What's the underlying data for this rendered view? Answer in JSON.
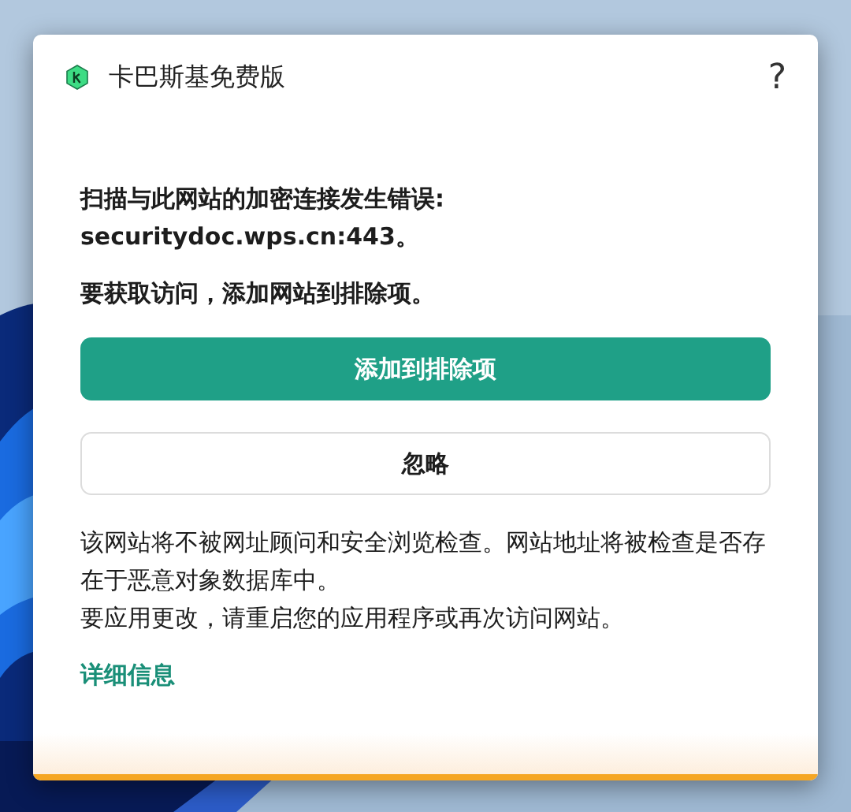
{
  "window": {
    "title": "卡巴斯基免费版",
    "help": "?"
  },
  "error_lines": [
    "扫描与此网站的加密连接发生错误:",
    "securitydoc.wps.cn:443。"
  ],
  "instruction": "要获取访问，添加网站到排除项。",
  "buttons": [
    {
      "label": "添加到排除项",
      "kind": "primary"
    },
    {
      "label": "忽略",
      "kind": "secondary"
    }
  ],
  "notes": [
    "该网站将不被网址顾问和安全浏览检查。网站地址将被检查是否存在于恶意对象数据库中。",
    "要应用更改，请重启您的应用程序或再次访问网站。"
  ],
  "link": "详细信息"
}
